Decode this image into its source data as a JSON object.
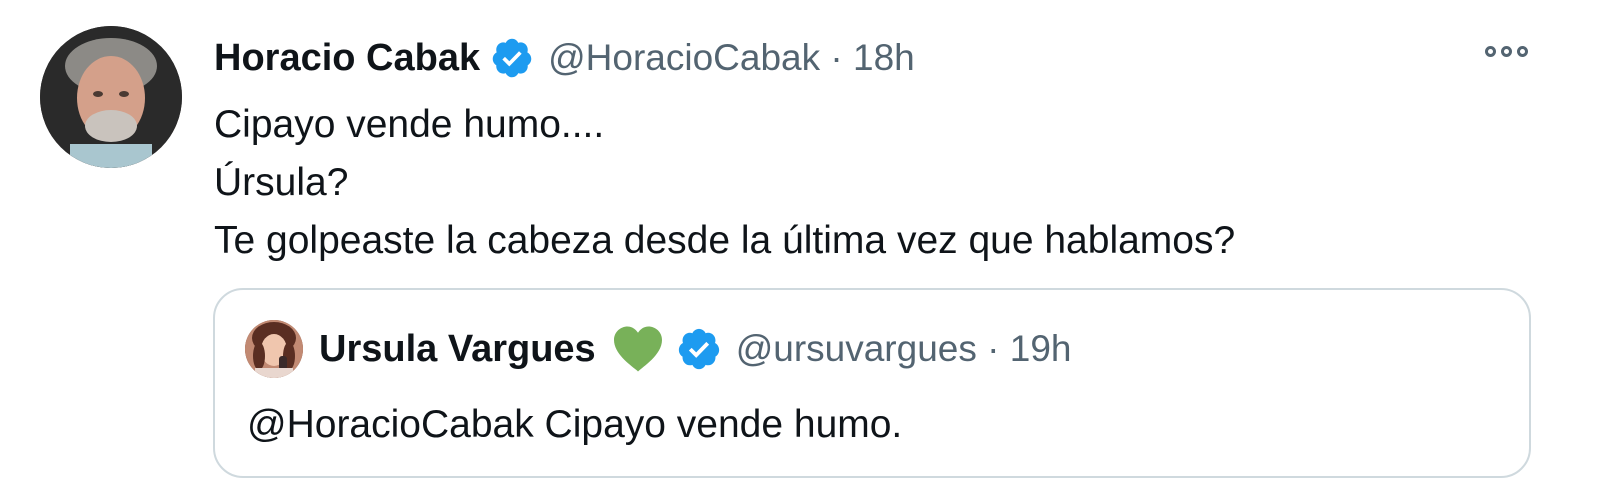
{
  "tweet": {
    "author": {
      "display_name": "Horacio Cabak",
      "handle": "@HoracioCabak",
      "time": "18h",
      "verified": true,
      "avatar_icon": "profile-photo"
    },
    "separator": "·",
    "text_lines": [
      "Cipayo vende humo....",
      "Úrsula?",
      "Te golpeaste la cabeza desde la última vez que hablamos?"
    ],
    "more_icon": "more-options-icon"
  },
  "quote": {
    "author": {
      "display_name": "Ursula Vargues",
      "emoji": "green-heart",
      "handle": "@ursuvargues",
      "time": "19h",
      "verified": true,
      "avatar_icon": "profile-photo"
    },
    "separator": "·",
    "text": "@HoracioCabak Cipayo vende humo."
  },
  "colors": {
    "verified_blue": "#1d9bf0",
    "secondary_text": "#536471",
    "border": "#cfd9de",
    "heart_green": "#78b159"
  }
}
